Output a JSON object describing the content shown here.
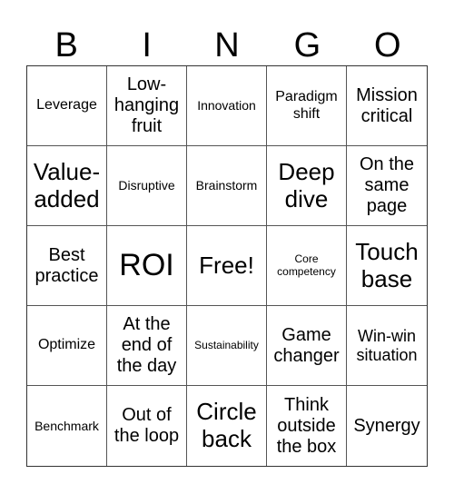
{
  "header": {
    "letters": [
      "B",
      "I",
      "N",
      "G",
      "O"
    ]
  },
  "board": {
    "rows": [
      [
        "Leverage",
        "Low-hanging fruit",
        "Innovation",
        "Paradigm shift",
        "Mission critical"
      ],
      [
        "Value-added",
        "Disruptive",
        "Brainstorm",
        "Deep dive",
        "On the same page"
      ],
      [
        "Best practice",
        "ROI",
        "Free!",
        "Core competency",
        "Touch base"
      ],
      [
        "Optimize",
        "At the end of the day",
        "Sustainability",
        "Game changer",
        "Win-win situation"
      ],
      [
        "Benchmark",
        "Out of the loop",
        "Circle back",
        "Think outside the box",
        "Synergy"
      ]
    ],
    "free_space": "Free!"
  }
}
